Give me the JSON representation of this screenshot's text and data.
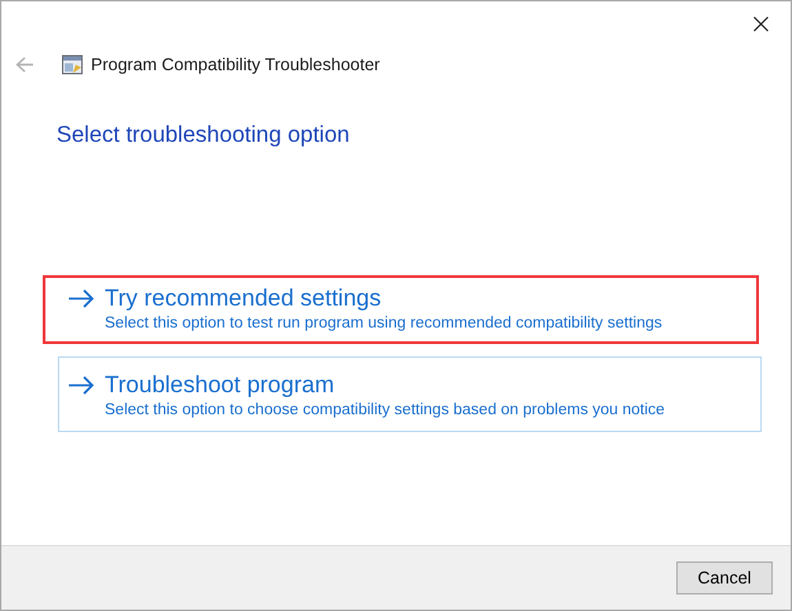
{
  "window": {
    "title": "Program Compatibility Troubleshooter"
  },
  "back_button": {
    "disabled": true
  },
  "heading": "Select troubleshooting option",
  "options": [
    {
      "title": "Try recommended settings",
      "description": "Select this option to test run program using recommended compatibility settings",
      "highlighted": true,
      "hovered": false
    },
    {
      "title": "Troubleshoot program",
      "description": "Select this option to choose compatibility settings based on problems you notice",
      "highlighted": false,
      "hovered": true
    }
  ],
  "buttons": [
    "Cancel"
  ]
}
